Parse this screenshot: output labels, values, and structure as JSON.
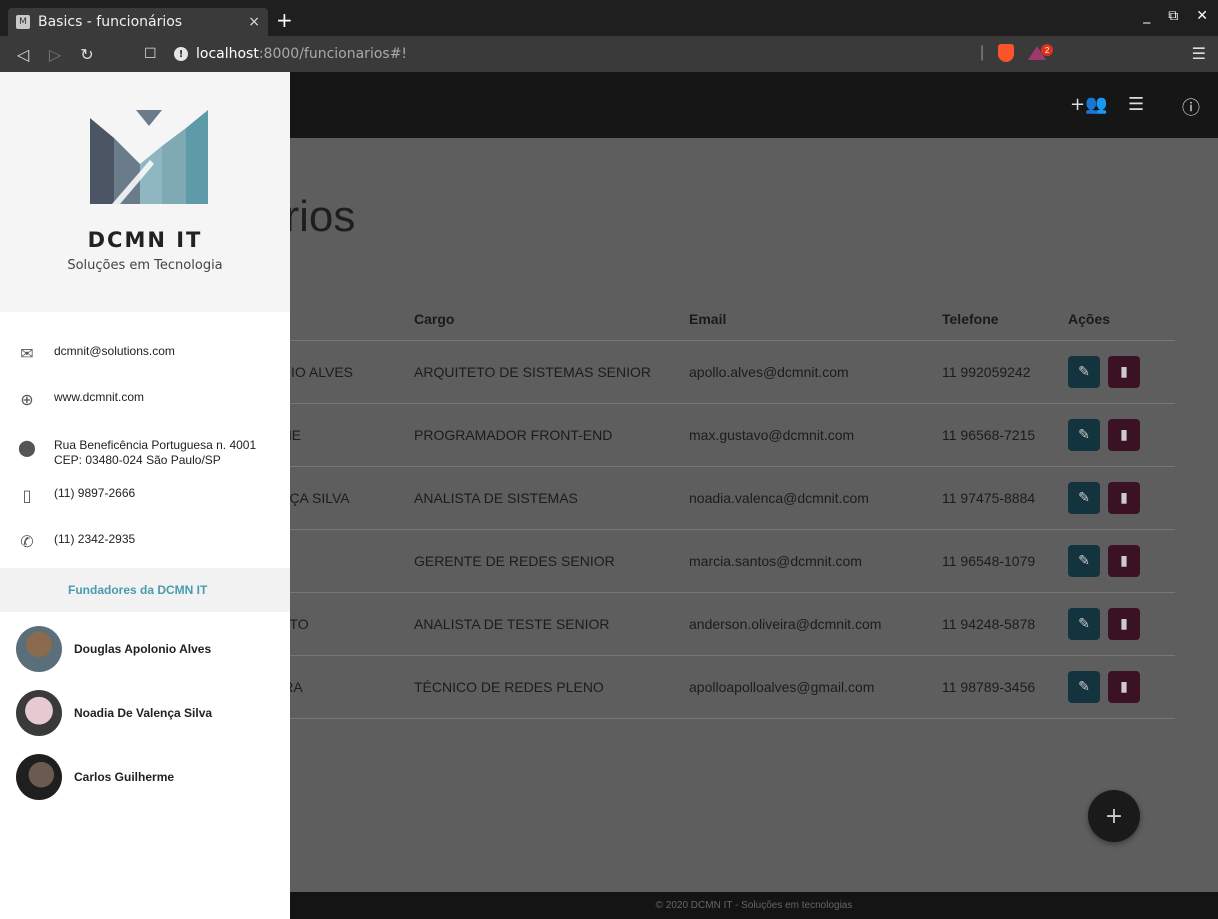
{
  "browser": {
    "tab_title": "Basics - funcionários",
    "tab_close": "×",
    "new_tab": "+",
    "url_host": "localhost",
    "url_path": ":8000/funcionarios#!",
    "badge_count": "2"
  },
  "sidebar": {
    "brand": "DCMN IT",
    "tagline": "Soluções em Tecnologia",
    "email": "dcmnit@solutions.com",
    "website": "www.dcmnit.com",
    "address_line1": "Rua Beneficência Portuguesa n. 4001",
    "address_line2": "CEP: 03480-024 São Paulo/SP",
    "mobile": "(11) 9897-2666",
    "phone": "(11) 2342-2935",
    "founders_heading": "Fundadores da DCMN IT",
    "founders": [
      {
        "name": "Douglas Apolonio Alves"
      },
      {
        "name": "Noadia De Valença Silva"
      },
      {
        "name": "Carlos Guilherme"
      }
    ]
  },
  "main": {
    "heading_visible": "ários",
    "columns": {
      "cargo": "Cargo",
      "email": "Email",
      "telefone": "Telefone",
      "acoes": "Ações"
    },
    "rows": [
      {
        "nome": "ONIO ALVES",
        "cargo": "ARQUITETO DE SISTEMAS SENIOR",
        "email": "apollo.alves@dcmnit.com",
        "telefone": "11 992059242"
      },
      {
        "nome": "RME",
        "cargo": "PROGRAMADOR FRONT-END",
        "email": "max.gustavo@dcmnit.com",
        "telefone": "11 96568-7215"
      },
      {
        "nome": "ENÇA SILVA",
        "cargo": "ANALISTA DE SISTEMAS",
        "email": "noadia.valenca@dcmnit.com",
        "telefone": "11 97475-8884"
      },
      {
        "nome": "",
        "cargo": "GERENTE DE REDES SENIOR",
        "email": "marcia.santos@dcmnit.com",
        "telefone": "11 96548-1079"
      },
      {
        "nome": "ENTO",
        "cargo": "ANALISTA DE TESTE SENIOR",
        "email": "anderson.oliveira@dcmnit.com",
        "telefone": "11 94248-5878"
      },
      {
        "nome": "EIRA",
        "cargo": "TÉCNICO DE REDES PLENO",
        "email": "apolloapolloalves@gmail.com",
        "telefone": "11 98789-3456"
      }
    ],
    "fab": "+"
  },
  "footer": {
    "text": "© 2020 DCMN IT - Soluções em tecnologias"
  },
  "colors": {
    "edit_button": "#13343e",
    "delete_button": "#3b1224",
    "founders_accent": "#4a9bb0",
    "appbar": "#161616"
  }
}
